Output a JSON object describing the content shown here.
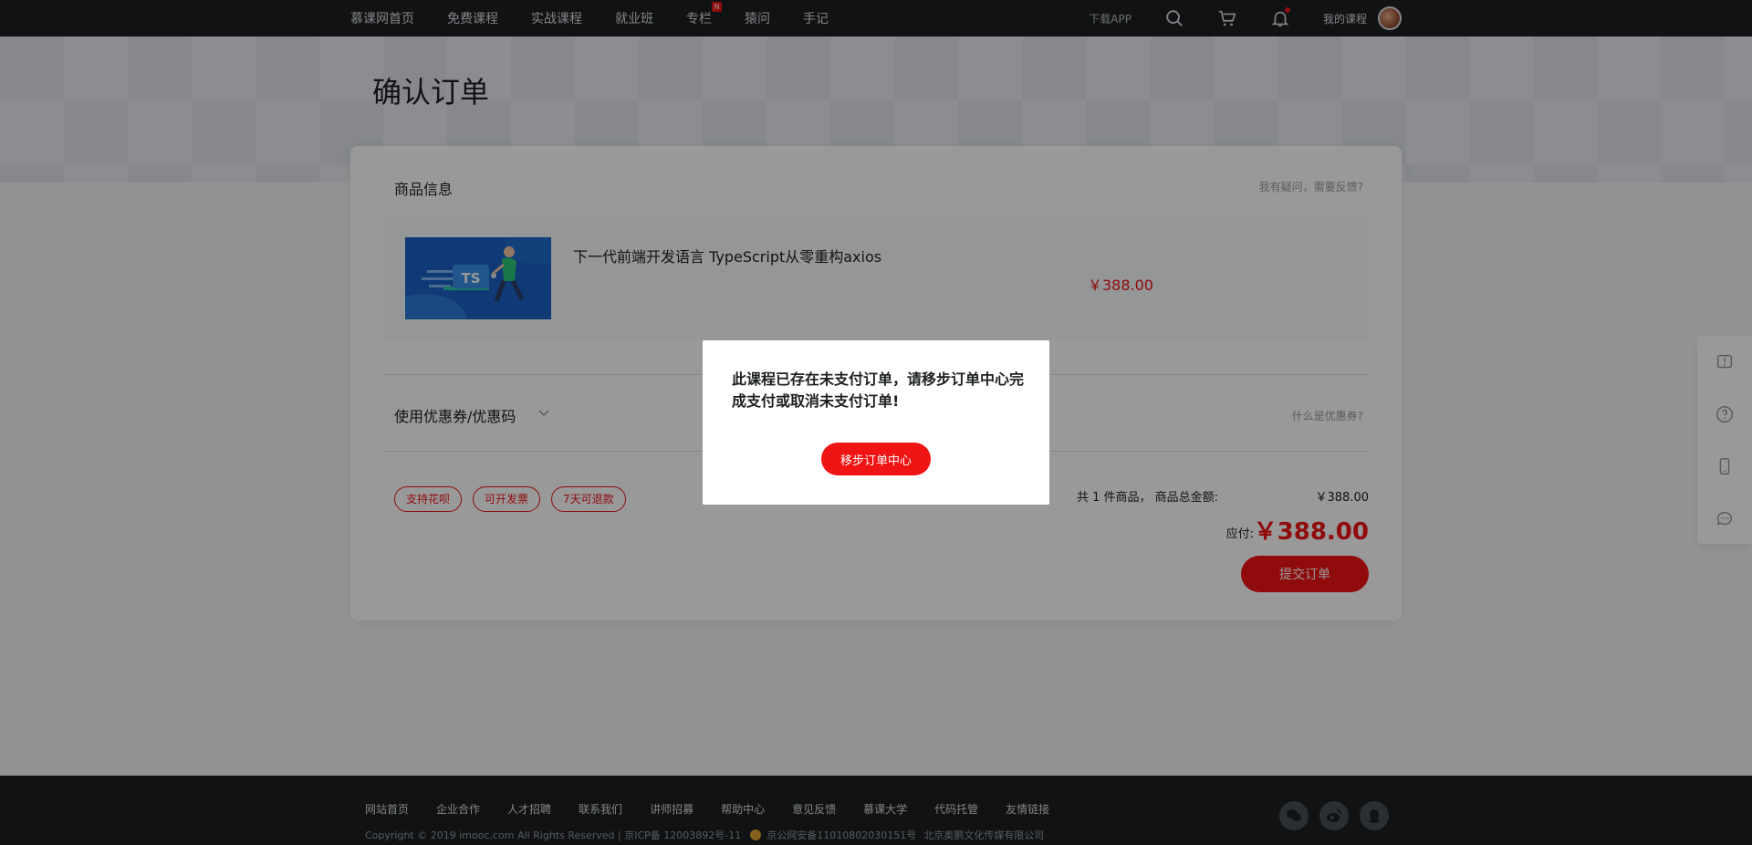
{
  "nav": {
    "links": [
      {
        "label": "慕课网首页"
      },
      {
        "label": "免费课程"
      },
      {
        "label": "实战课程"
      },
      {
        "label": "就业班"
      },
      {
        "label": "专栏",
        "badge": "N"
      },
      {
        "label": "猿问"
      },
      {
        "label": "手记"
      }
    ],
    "download_app": "下载APP",
    "my_course": "我的课程",
    "icons": [
      "search-icon",
      "cart-icon",
      "bell-icon"
    ]
  },
  "page": {
    "title": "确认订单"
  },
  "order": {
    "section_title": "商品信息",
    "feedback_link": "我有疑问，需要反馈?",
    "product": {
      "thumbnail_text": "TS",
      "name": "下一代前端开发语言 TypeScript从零重构axios",
      "price": "￥388.00"
    },
    "coupon": {
      "label": "使用优惠券/优惠码",
      "help": "什么是优惠券?"
    },
    "tags": [
      "支持花呗",
      "可开发票",
      "7天可退款"
    ],
    "summary": {
      "count_text": "共 1 件商品，  商品总金额:",
      "total": "￥388.00",
      "pay_label": "应付:",
      "pay_amount": "￥388.00"
    },
    "submit_label": "提交订单"
  },
  "dialog": {
    "message": "此课程已存在未支付订单，请移步订单中心完成支付或取消未支付订单!",
    "button_label": "移步订单中心"
  },
  "sidebar": [
    "feedback-icon",
    "help-icon",
    "mobile-icon",
    "chat-icon"
  ],
  "footer": {
    "links": [
      "网站首页",
      "企业合作",
      "人才招聘",
      "联系我们",
      "讲师招募",
      "帮助中心",
      "意见反馈",
      "慕课大学",
      "代码托管",
      "友情链接"
    ],
    "copyright": "Copyright   © 2019 imooc.com All Rights Reserved | 京ICP备 12003892号-11",
    "police": "京公网安备11010802030151号",
    "company": "北京奥鹏文化传媒有限公司",
    "social": [
      "wechat-icon",
      "weibo-icon",
      "qq-icon"
    ]
  },
  "colors": {
    "accent": "#f01414",
    "dark": "#1c1f21",
    "muted": "#93999f"
  }
}
